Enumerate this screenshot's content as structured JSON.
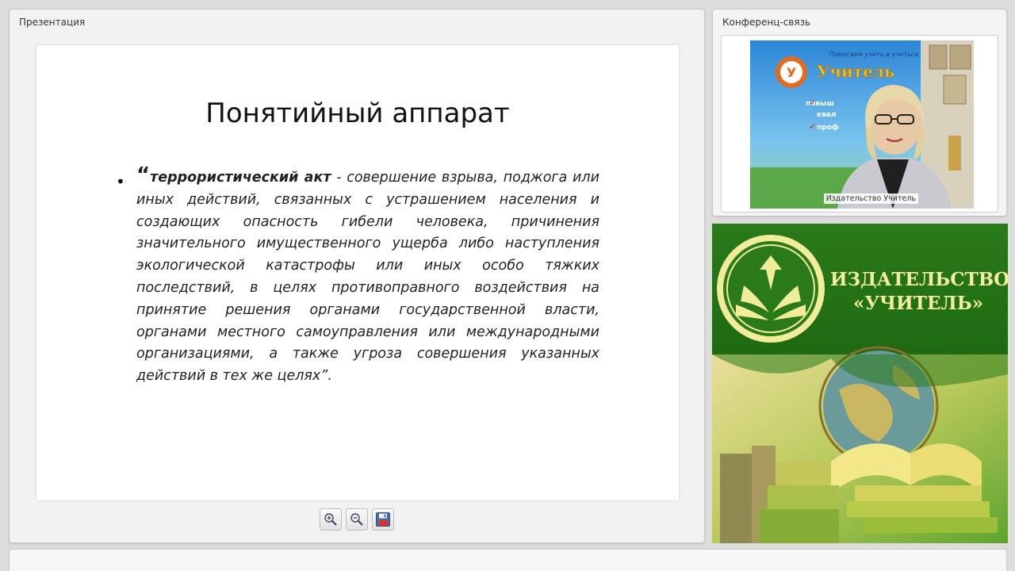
{
  "presentation": {
    "panel_title": "Презентация",
    "slide": {
      "title": "Понятийный аппарат",
      "bullet": "•",
      "quote_open": "“",
      "term": "террористический акт",
      "definition": " - совершение взрыва, поджога или иных действий, связанных с устрашением населения и создающих опасность гибели человека, причинения значительного имущественного ущерба либо наступления экологической катастрофы или иных особо тяжких последствий, в целях противоправного воздействия на принятие решения органами государственной власти, органами местного самоуправления или международными организациями, а также угроза совершения указанных действий в тех же целях",
      "quote_close": "”."
    },
    "toolbar": {
      "zoom_in": "zoom-in-icon",
      "zoom_out": "zoom-out-icon",
      "save": "save-icon"
    }
  },
  "conference": {
    "panel_title": "Конференц-связь",
    "video_caption": "Издательство Учитель",
    "poster_top_line": "Помогаем учить и учиться",
    "poster_brand": "Учитель",
    "poster_items": [
      "повыш",
      "квал",
      "проф"
    ]
  },
  "banner": {
    "title_line1": "ИЗДАТЕЛЬСТВО",
    "title_line2": "«УЧИТЕЛЬ»",
    "colors": {
      "green_dark": "#2f7d1c",
      "green_light": "#8fc33a",
      "logo_yellow": "#f1ec9a"
    }
  }
}
